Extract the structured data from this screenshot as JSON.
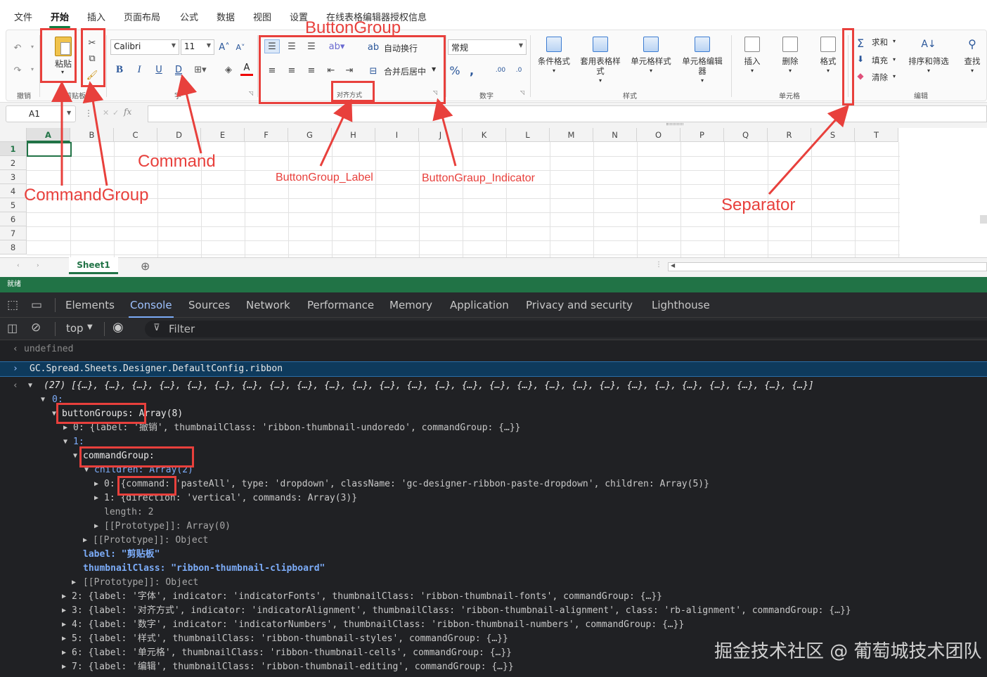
{
  "menu": [
    "文件",
    "开始",
    "插入",
    "页面布局",
    "公式",
    "数据",
    "视图",
    "设置",
    "在线表格编辑器授权信息"
  ],
  "ribbon": {
    "undo_label": "撤销",
    "paste_label": "粘贴",
    "clipboard_label": "剪贴板",
    "font_name": "Calibri",
    "font_size": "11",
    "font_group_label": "字",
    "wrap_text": "自动换行",
    "merge_center": "合并后居中",
    "alignment_label": "对齐方式",
    "number_format": "常规",
    "number_label": "数字",
    "styles": [
      "条件格式",
      "套用表格样式",
      "单元格样式",
      "单元格编辑器"
    ],
    "styles_label": "样式",
    "cells": [
      "插入",
      "删除",
      "格式"
    ],
    "cells_label": "单元格",
    "sum": "求和",
    "fill": "填充",
    "clear": "清除",
    "sort_filter": "排序和筛选",
    "find": "查找",
    "editing_label": "编辑"
  },
  "formula": {
    "name_box": "A1",
    "fx": "fx"
  },
  "grid": {
    "columns": [
      "A",
      "B",
      "C",
      "D",
      "E",
      "F",
      "G",
      "H",
      "I",
      "J",
      "K",
      "L",
      "M",
      "N",
      "O",
      "P",
      "Q",
      "R",
      "S",
      "T"
    ],
    "rows": [
      "1",
      "2",
      "3",
      "4",
      "5",
      "6",
      "7",
      "8"
    ]
  },
  "sheet_tab": "Sheet1",
  "status": "就绪",
  "devtools": {
    "tabs": [
      "Elements",
      "Console",
      "Sources",
      "Network",
      "Performance",
      "Memory",
      "Application",
      "Privacy and security",
      "Lighthouse"
    ],
    "context": "top",
    "filter": "Filter",
    "console_lines": [
      "undefined",
      "GC.Spread.Sheets.Designer.DefaultConfig.ribbon",
      "(27) [{…}, {…}, {…}, {…}, {…}, {…}, {…}, {…}, {…}, {…}, {…}, {…}, {…}, {…}, {…}, {…}, {…}, {…}, {…}, {…}, {…}, {…}, {…}, {…}, {…}, {…}, {…}]",
      "0:",
      "buttonGroups: Array(8)",
      "0: {label: '撤销', thumbnailClass: 'ribbon-thumbnail-undoredo', commandGroup: {…}}",
      "1:",
      "commandGroup:",
      "children: Array(2)",
      "0: {command: 'pasteAll', type: 'dropdown', className: 'gc-designer-ribbon-paste-dropdown', children: Array(5)}",
      "1: {direction: 'vertical', commands: Array(3)}",
      "length: 2",
      "[[Prototype]]: Array(0)",
      "[[Prototype]]: Object",
      "label: \"剪贴板\"",
      "thumbnailClass: \"ribbon-thumbnail-clipboard\"",
      "[[Prototype]]: Object",
      "2: {label: '字体', indicator: 'indicatorFonts', thumbnailClass: 'ribbon-thumbnail-fonts', commandGroup: {…}}",
      "3: {label: '对齐方式', indicator: 'indicatorAlignment', thumbnailClass: 'ribbon-thumbnail-alignment', class: 'rb-alignment', commandGroup: {…}}",
      "4: {label: '数字', indicator: 'indicatorNumbers', thumbnailClass: 'ribbon-thumbnail-numbers', commandGroup: {…}}",
      "5: {label: '样式', thumbnailClass: 'ribbon-thumbnail-styles', commandGroup: {…}}",
      "6: {label: '单元格', thumbnailClass: 'ribbon-thumbnail-cells', commandGroup: {…}}",
      "7: {label: '编辑', thumbnailClass: 'ribbon-thumbnail-editing', commandGroup: {…}}"
    ]
  },
  "annotations": {
    "button_group": "ButtonGroup",
    "command": "Command",
    "command_group": "CommandGroup",
    "bg_label": "ButtonGroup_Label",
    "bg_indicator": "ButtonGraup_Indicator",
    "separator": "Separator"
  },
  "watermark": "掘金技术社区 @ 葡萄城技术团队",
  "colors": {
    "accent": "#217346",
    "annotation": "#e8403c",
    "devtools_bg": "#202124"
  }
}
